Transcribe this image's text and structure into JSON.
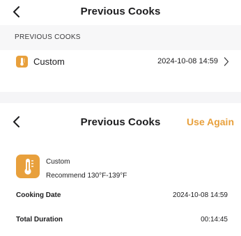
{
  "screen1": {
    "title": "Previous Cooks",
    "section_header": "PREVIOUS COOKS",
    "item": {
      "name": "Custom",
      "date": "2024-10-08  14:59"
    }
  },
  "screen2": {
    "title": "Previous Cooks",
    "use_again": "Use Again",
    "card": {
      "name": "Custom",
      "recommend": "Recommend 130°F-139°F"
    },
    "cooking_date_label": "Cooking Date",
    "cooking_date_value": "2024-10-08  14:59",
    "total_duration_label": "Total Duration",
    "total_duration_value": "00:14:45"
  },
  "colors": {
    "accent": "#e8a03c"
  },
  "icons": {
    "back": "chevron-left-icon",
    "item": "thermometer-icon",
    "disclosure": "chevron-right-icon"
  }
}
